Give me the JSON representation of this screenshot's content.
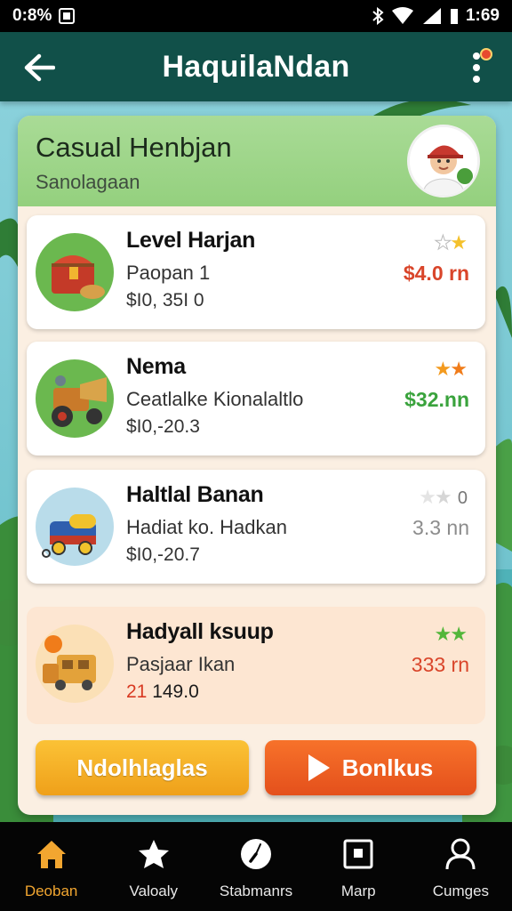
{
  "status_bar": {
    "time_left": "0:8%",
    "time_right": "1:69"
  },
  "header": {
    "title": "HaquilaNdan",
    "back_icon": "arrow-left-icon",
    "menu_icon": "more-vertical-icon"
  },
  "panel": {
    "title": "Casual Henbjan",
    "subtitle": "Sanolagaan"
  },
  "cards": [
    {
      "title": "Level Harjan",
      "subtitle": "Paopan 1",
      "range": "$I0, 35I 0",
      "price": "$4.0 rn",
      "price_color": "#d9452a",
      "stars": [
        "empty",
        "gold"
      ],
      "icon": "treasure-chest-icon"
    },
    {
      "title": "Nema",
      "subtitle": "Ceatlalke Kionalaltlo",
      "range": "$I0,-20.3",
      "price": "$32.nn",
      "price_color": "#3aa33d",
      "stars": [
        "orange",
        "orange"
      ],
      "icon": "tractor-icon"
    },
    {
      "title": "Haltlal Banan",
      "subtitle": "Hadiat ko. Hadkan",
      "range": "$I0,-20.7",
      "price": "3.3 nn",
      "price_color": "#8c8c8c",
      "stars": [
        "empty",
        "empty"
      ],
      "stars_suffix": "0",
      "icon": "toy-train-icon"
    },
    {
      "title": "Hadyall ksuup",
      "subtitle": "Pasjaar Ikan",
      "range_prefix": "21",
      "range": " 149.0",
      "price": "333 rn",
      "price_color": "#d9452a",
      "stars": [
        "green",
        "green"
      ],
      "icon": "delivery-truck-icon"
    }
  ],
  "buttons": {
    "left_label": "Ndolhlaglas",
    "right_label": "Bonlkus"
  },
  "nav": [
    {
      "label": "Deoban",
      "icon": "home-icon",
      "active": true
    },
    {
      "label": "Valoaly",
      "icon": "star-icon",
      "active": false
    },
    {
      "label": "Stabmanrs",
      "icon": "clock-icon",
      "active": false
    },
    {
      "label": "Marp",
      "icon": "map-icon",
      "active": false
    },
    {
      "label": "Cumges",
      "icon": "user-icon",
      "active": false
    }
  ],
  "colors": {
    "header_bg": "#115049",
    "panel_header_bg": "#a9db96",
    "button_left": "#f6b12a",
    "button_right": "#ee5e22",
    "nav_active": "#f2a630"
  }
}
